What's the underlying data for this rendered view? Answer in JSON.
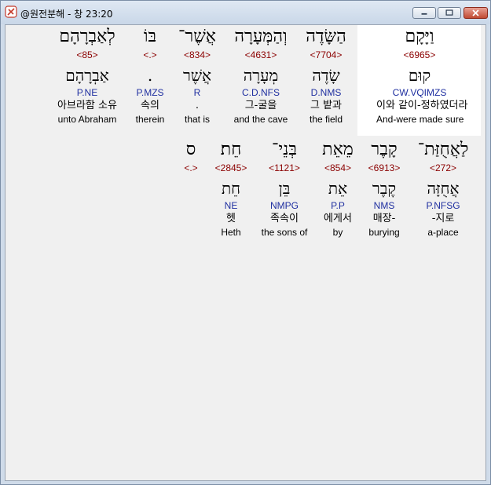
{
  "window": {
    "title": "@원전분해 - 창 23:20"
  },
  "row1": [
    {
      "hebrew": "וַיָּקָם",
      "strong": "<6965>",
      "lexeme": "קוּם",
      "parse": "CW.VQIMZS",
      "korean": "이와 같이-정하였더라",
      "english": "And-were made sure"
    },
    {
      "hebrew": "הַשָּׂדֶה",
      "strong": "<7704>",
      "lexeme": "שָׂדֶה",
      "parse": "D.NMS",
      "korean": "그 밭과",
      "english": "the field"
    },
    {
      "hebrew": "וְהַמְּעָרָה",
      "strong": "<4631>",
      "lexeme": "מְעָרָה",
      "parse": "C.D.NFS",
      "korean": "그-굴을",
      "english": "and the cave"
    },
    {
      "hebrew": "אֲשֶׁר־",
      "strong": "<834>",
      "lexeme": "אֲשֶׁר",
      "parse": "R",
      "korean": ".",
      "english": "that is"
    },
    {
      "hebrew": "בּוֹ",
      "strong": "<.>",
      "lexeme": ".",
      "parse": "P.MZS",
      "korean": "속의",
      "english": "therein"
    },
    {
      "hebrew": "לְאַבְרָהָם",
      "strong": "<85>",
      "lexeme": "אַבְרָהָם",
      "parse": "P.NE",
      "korean": "아브라함 소유",
      "english": "unto Abraham"
    }
  ],
  "row2": [
    {
      "hebrew": "לַאֲחֻזַּת־",
      "strong": "<272>",
      "lexeme": "אֲחֻזָּה",
      "parse": "P.NFSG",
      "korean": "-지로",
      "english": "a-place"
    },
    {
      "hebrew": "קָבֶר",
      "strong": "<6913>",
      "lexeme": "קֶבֶר",
      "parse": "NMS",
      "korean": "매장-",
      "english": "burying"
    },
    {
      "hebrew": "מֵאֵת",
      "strong": "<854>",
      "lexeme": "אֵת",
      "parse": "P.P",
      "korean": "에게서",
      "english": "by"
    },
    {
      "hebrew": "בְּנֵי־",
      "strong": "<1121>",
      "lexeme": "בֵּן",
      "parse": "NMPG",
      "korean": "족속이",
      "english": "the sons of"
    },
    {
      "hebrew": "חֵת׃",
      "strong": "<2845>",
      "lexeme": "חֵת",
      "parse": "NE",
      "korean": "헷",
      "english": "Heth"
    },
    {
      "hebrew": "ס",
      "strong": "<.>",
      "lexeme": "",
      "parse": "",
      "korean": "",
      "english": ""
    }
  ]
}
